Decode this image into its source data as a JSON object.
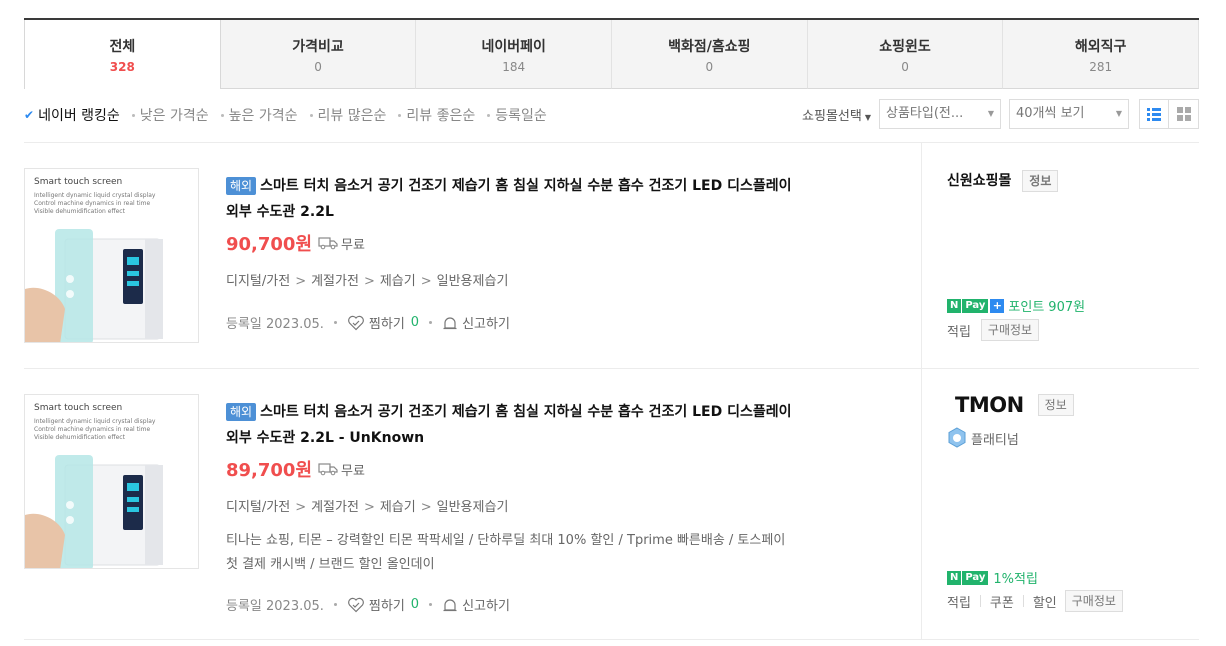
{
  "tabs": [
    {
      "label": "전체",
      "count": "328"
    },
    {
      "label": "가격비교",
      "count": "0"
    },
    {
      "label": "네이버페이",
      "count": "184"
    },
    {
      "label": "백화점/홈쇼핑",
      "count": "0"
    },
    {
      "label": "쇼핑윈도",
      "count": "0"
    },
    {
      "label": "해외직구",
      "count": "281"
    }
  ],
  "sort": {
    "options": [
      "네이버 랭킹순",
      "낮은 가격순",
      "높은 가격순",
      "리뷰 많은순",
      "리뷰 좋은순",
      "등록일순"
    ],
    "mall_select": "쇼핑몰선택",
    "product_type": "상품타입(전...",
    "per_page": "40개씩 보기"
  },
  "products": [
    {
      "thumb_caption": "Smart touch screen",
      "thumb_sub": [
        "Intelligent dynamic liquid crystal display",
        "Control machine dynamics in real time",
        "Visible dehumidification effect"
      ],
      "badge": "해외",
      "title_line1": "스마트 터치 음소거 공기 건조기 제습기 홈 침실 지하실 수분 흡수 건조기 LED 디스플레이",
      "title_line2": "외부 수도관 2.2L",
      "price": "90,700원",
      "shipping": "무료",
      "categories": [
        "디지털/가전",
        "계절가전",
        "제습기",
        "일반용제습기"
      ],
      "reg_date": "등록일 2023.05.",
      "wish_label": "찜하기",
      "wish_count": "0",
      "report_label": "신고하기",
      "mall_name": "신원쇼핑몰",
      "info_label": "정보",
      "pay_label": "Pay",
      "point_text": "포인트",
      "point_value": "907원",
      "links": [
        "적립"
      ],
      "purchase_info": "구매정보"
    },
    {
      "thumb_caption": "Smart touch screen",
      "thumb_sub": [
        "Intelligent dynamic liquid crystal display",
        "Control machine dynamics in real time",
        "Visible dehumidification effect"
      ],
      "badge": "해외",
      "title_line1": "스마트 터치 음소거 공기 건조기 제습기 홈 침실 지하실 수분 흡수 건조기 LED 디스플레이",
      "title_line2": "외부 수도관 2.2L - UnKnown",
      "price": "89,700원",
      "shipping": "무료",
      "categories": [
        "디지털/가전",
        "계절가전",
        "제습기",
        "일반용제습기"
      ],
      "desc_line1": "티나는 쇼핑, 티몬 – 강력할인 티몬 팍팍세일 / 단하루딜 최대 10% 할인 / Tprime 빠른배송 / 토스페이",
      "desc_line2": "첫 결제 캐시백 / 브랜드 할인 올인데이",
      "reg_date": "등록일 2023.05.",
      "wish_label": "찜하기",
      "wish_count": "0",
      "report_label": "신고하기",
      "mall_logo": "TMON",
      "info_label": "정보",
      "grade": "플래티넘",
      "pay_label": "Pay",
      "pay_benefit": "1%적립",
      "links": [
        "적립",
        "쿠폰",
        "할인"
      ],
      "purchase_info": "구매정보"
    }
  ]
}
